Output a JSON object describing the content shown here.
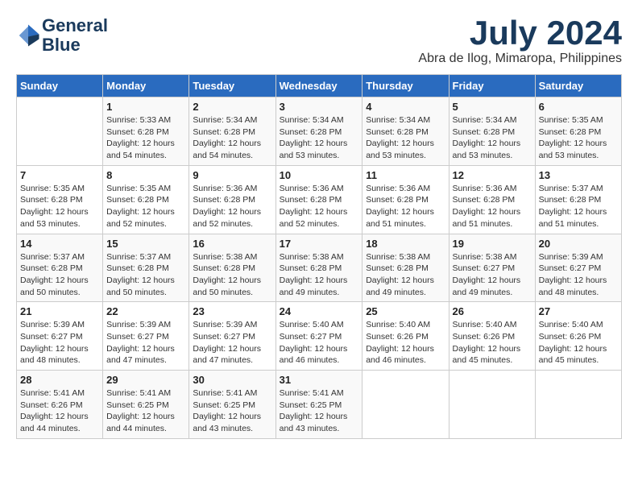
{
  "logo": {
    "line1": "General",
    "line2": "Blue"
  },
  "title": "July 2024",
  "subtitle": "Abra de Ilog, Mimaropa, Philippines",
  "days_of_week": [
    "Sunday",
    "Monday",
    "Tuesday",
    "Wednesday",
    "Thursday",
    "Friday",
    "Saturday"
  ],
  "weeks": [
    [
      {
        "day": "",
        "sunrise": "",
        "sunset": "",
        "daylight": ""
      },
      {
        "day": "1",
        "sunrise": "Sunrise: 5:33 AM",
        "sunset": "Sunset: 6:28 PM",
        "daylight": "Daylight: 12 hours and 54 minutes."
      },
      {
        "day": "2",
        "sunrise": "Sunrise: 5:34 AM",
        "sunset": "Sunset: 6:28 PM",
        "daylight": "Daylight: 12 hours and 54 minutes."
      },
      {
        "day": "3",
        "sunrise": "Sunrise: 5:34 AM",
        "sunset": "Sunset: 6:28 PM",
        "daylight": "Daylight: 12 hours and 53 minutes."
      },
      {
        "day": "4",
        "sunrise": "Sunrise: 5:34 AM",
        "sunset": "Sunset: 6:28 PM",
        "daylight": "Daylight: 12 hours and 53 minutes."
      },
      {
        "day": "5",
        "sunrise": "Sunrise: 5:34 AM",
        "sunset": "Sunset: 6:28 PM",
        "daylight": "Daylight: 12 hours and 53 minutes."
      },
      {
        "day": "6",
        "sunrise": "Sunrise: 5:35 AM",
        "sunset": "Sunset: 6:28 PM",
        "daylight": "Daylight: 12 hours and 53 minutes."
      }
    ],
    [
      {
        "day": "7",
        "sunrise": "Sunrise: 5:35 AM",
        "sunset": "Sunset: 6:28 PM",
        "daylight": "Daylight: 12 hours and 53 minutes."
      },
      {
        "day": "8",
        "sunrise": "Sunrise: 5:35 AM",
        "sunset": "Sunset: 6:28 PM",
        "daylight": "Daylight: 12 hours and 52 minutes."
      },
      {
        "day": "9",
        "sunrise": "Sunrise: 5:36 AM",
        "sunset": "Sunset: 6:28 PM",
        "daylight": "Daylight: 12 hours and 52 minutes."
      },
      {
        "day": "10",
        "sunrise": "Sunrise: 5:36 AM",
        "sunset": "Sunset: 6:28 PM",
        "daylight": "Daylight: 12 hours and 52 minutes."
      },
      {
        "day": "11",
        "sunrise": "Sunrise: 5:36 AM",
        "sunset": "Sunset: 6:28 PM",
        "daylight": "Daylight: 12 hours and 51 minutes."
      },
      {
        "day": "12",
        "sunrise": "Sunrise: 5:36 AM",
        "sunset": "Sunset: 6:28 PM",
        "daylight": "Daylight: 12 hours and 51 minutes."
      },
      {
        "day": "13",
        "sunrise": "Sunrise: 5:37 AM",
        "sunset": "Sunset: 6:28 PM",
        "daylight": "Daylight: 12 hours and 51 minutes."
      }
    ],
    [
      {
        "day": "14",
        "sunrise": "Sunrise: 5:37 AM",
        "sunset": "Sunset: 6:28 PM",
        "daylight": "Daylight: 12 hours and 50 minutes."
      },
      {
        "day": "15",
        "sunrise": "Sunrise: 5:37 AM",
        "sunset": "Sunset: 6:28 PM",
        "daylight": "Daylight: 12 hours and 50 minutes."
      },
      {
        "day": "16",
        "sunrise": "Sunrise: 5:38 AM",
        "sunset": "Sunset: 6:28 PM",
        "daylight": "Daylight: 12 hours and 50 minutes."
      },
      {
        "day": "17",
        "sunrise": "Sunrise: 5:38 AM",
        "sunset": "Sunset: 6:28 PM",
        "daylight": "Daylight: 12 hours and 49 minutes."
      },
      {
        "day": "18",
        "sunrise": "Sunrise: 5:38 AM",
        "sunset": "Sunset: 6:28 PM",
        "daylight": "Daylight: 12 hours and 49 minutes."
      },
      {
        "day": "19",
        "sunrise": "Sunrise: 5:38 AM",
        "sunset": "Sunset: 6:27 PM",
        "daylight": "Daylight: 12 hours and 49 minutes."
      },
      {
        "day": "20",
        "sunrise": "Sunrise: 5:39 AM",
        "sunset": "Sunset: 6:27 PM",
        "daylight": "Daylight: 12 hours and 48 minutes."
      }
    ],
    [
      {
        "day": "21",
        "sunrise": "Sunrise: 5:39 AM",
        "sunset": "Sunset: 6:27 PM",
        "daylight": "Daylight: 12 hours and 48 minutes."
      },
      {
        "day": "22",
        "sunrise": "Sunrise: 5:39 AM",
        "sunset": "Sunset: 6:27 PM",
        "daylight": "Daylight: 12 hours and 47 minutes."
      },
      {
        "day": "23",
        "sunrise": "Sunrise: 5:39 AM",
        "sunset": "Sunset: 6:27 PM",
        "daylight": "Daylight: 12 hours and 47 minutes."
      },
      {
        "day": "24",
        "sunrise": "Sunrise: 5:40 AM",
        "sunset": "Sunset: 6:27 PM",
        "daylight": "Daylight: 12 hours and 46 minutes."
      },
      {
        "day": "25",
        "sunrise": "Sunrise: 5:40 AM",
        "sunset": "Sunset: 6:26 PM",
        "daylight": "Daylight: 12 hours and 46 minutes."
      },
      {
        "day": "26",
        "sunrise": "Sunrise: 5:40 AM",
        "sunset": "Sunset: 6:26 PM",
        "daylight": "Daylight: 12 hours and 45 minutes."
      },
      {
        "day": "27",
        "sunrise": "Sunrise: 5:40 AM",
        "sunset": "Sunset: 6:26 PM",
        "daylight": "Daylight: 12 hours and 45 minutes."
      }
    ],
    [
      {
        "day": "28",
        "sunrise": "Sunrise: 5:41 AM",
        "sunset": "Sunset: 6:26 PM",
        "daylight": "Daylight: 12 hours and 44 minutes."
      },
      {
        "day": "29",
        "sunrise": "Sunrise: 5:41 AM",
        "sunset": "Sunset: 6:25 PM",
        "daylight": "Daylight: 12 hours and 44 minutes."
      },
      {
        "day": "30",
        "sunrise": "Sunrise: 5:41 AM",
        "sunset": "Sunset: 6:25 PM",
        "daylight": "Daylight: 12 hours and 43 minutes."
      },
      {
        "day": "31",
        "sunrise": "Sunrise: 5:41 AM",
        "sunset": "Sunset: 6:25 PM",
        "daylight": "Daylight: 12 hours and 43 minutes."
      },
      {
        "day": "",
        "sunrise": "",
        "sunset": "",
        "daylight": ""
      },
      {
        "day": "",
        "sunrise": "",
        "sunset": "",
        "daylight": ""
      },
      {
        "day": "",
        "sunrise": "",
        "sunset": "",
        "daylight": ""
      }
    ]
  ]
}
